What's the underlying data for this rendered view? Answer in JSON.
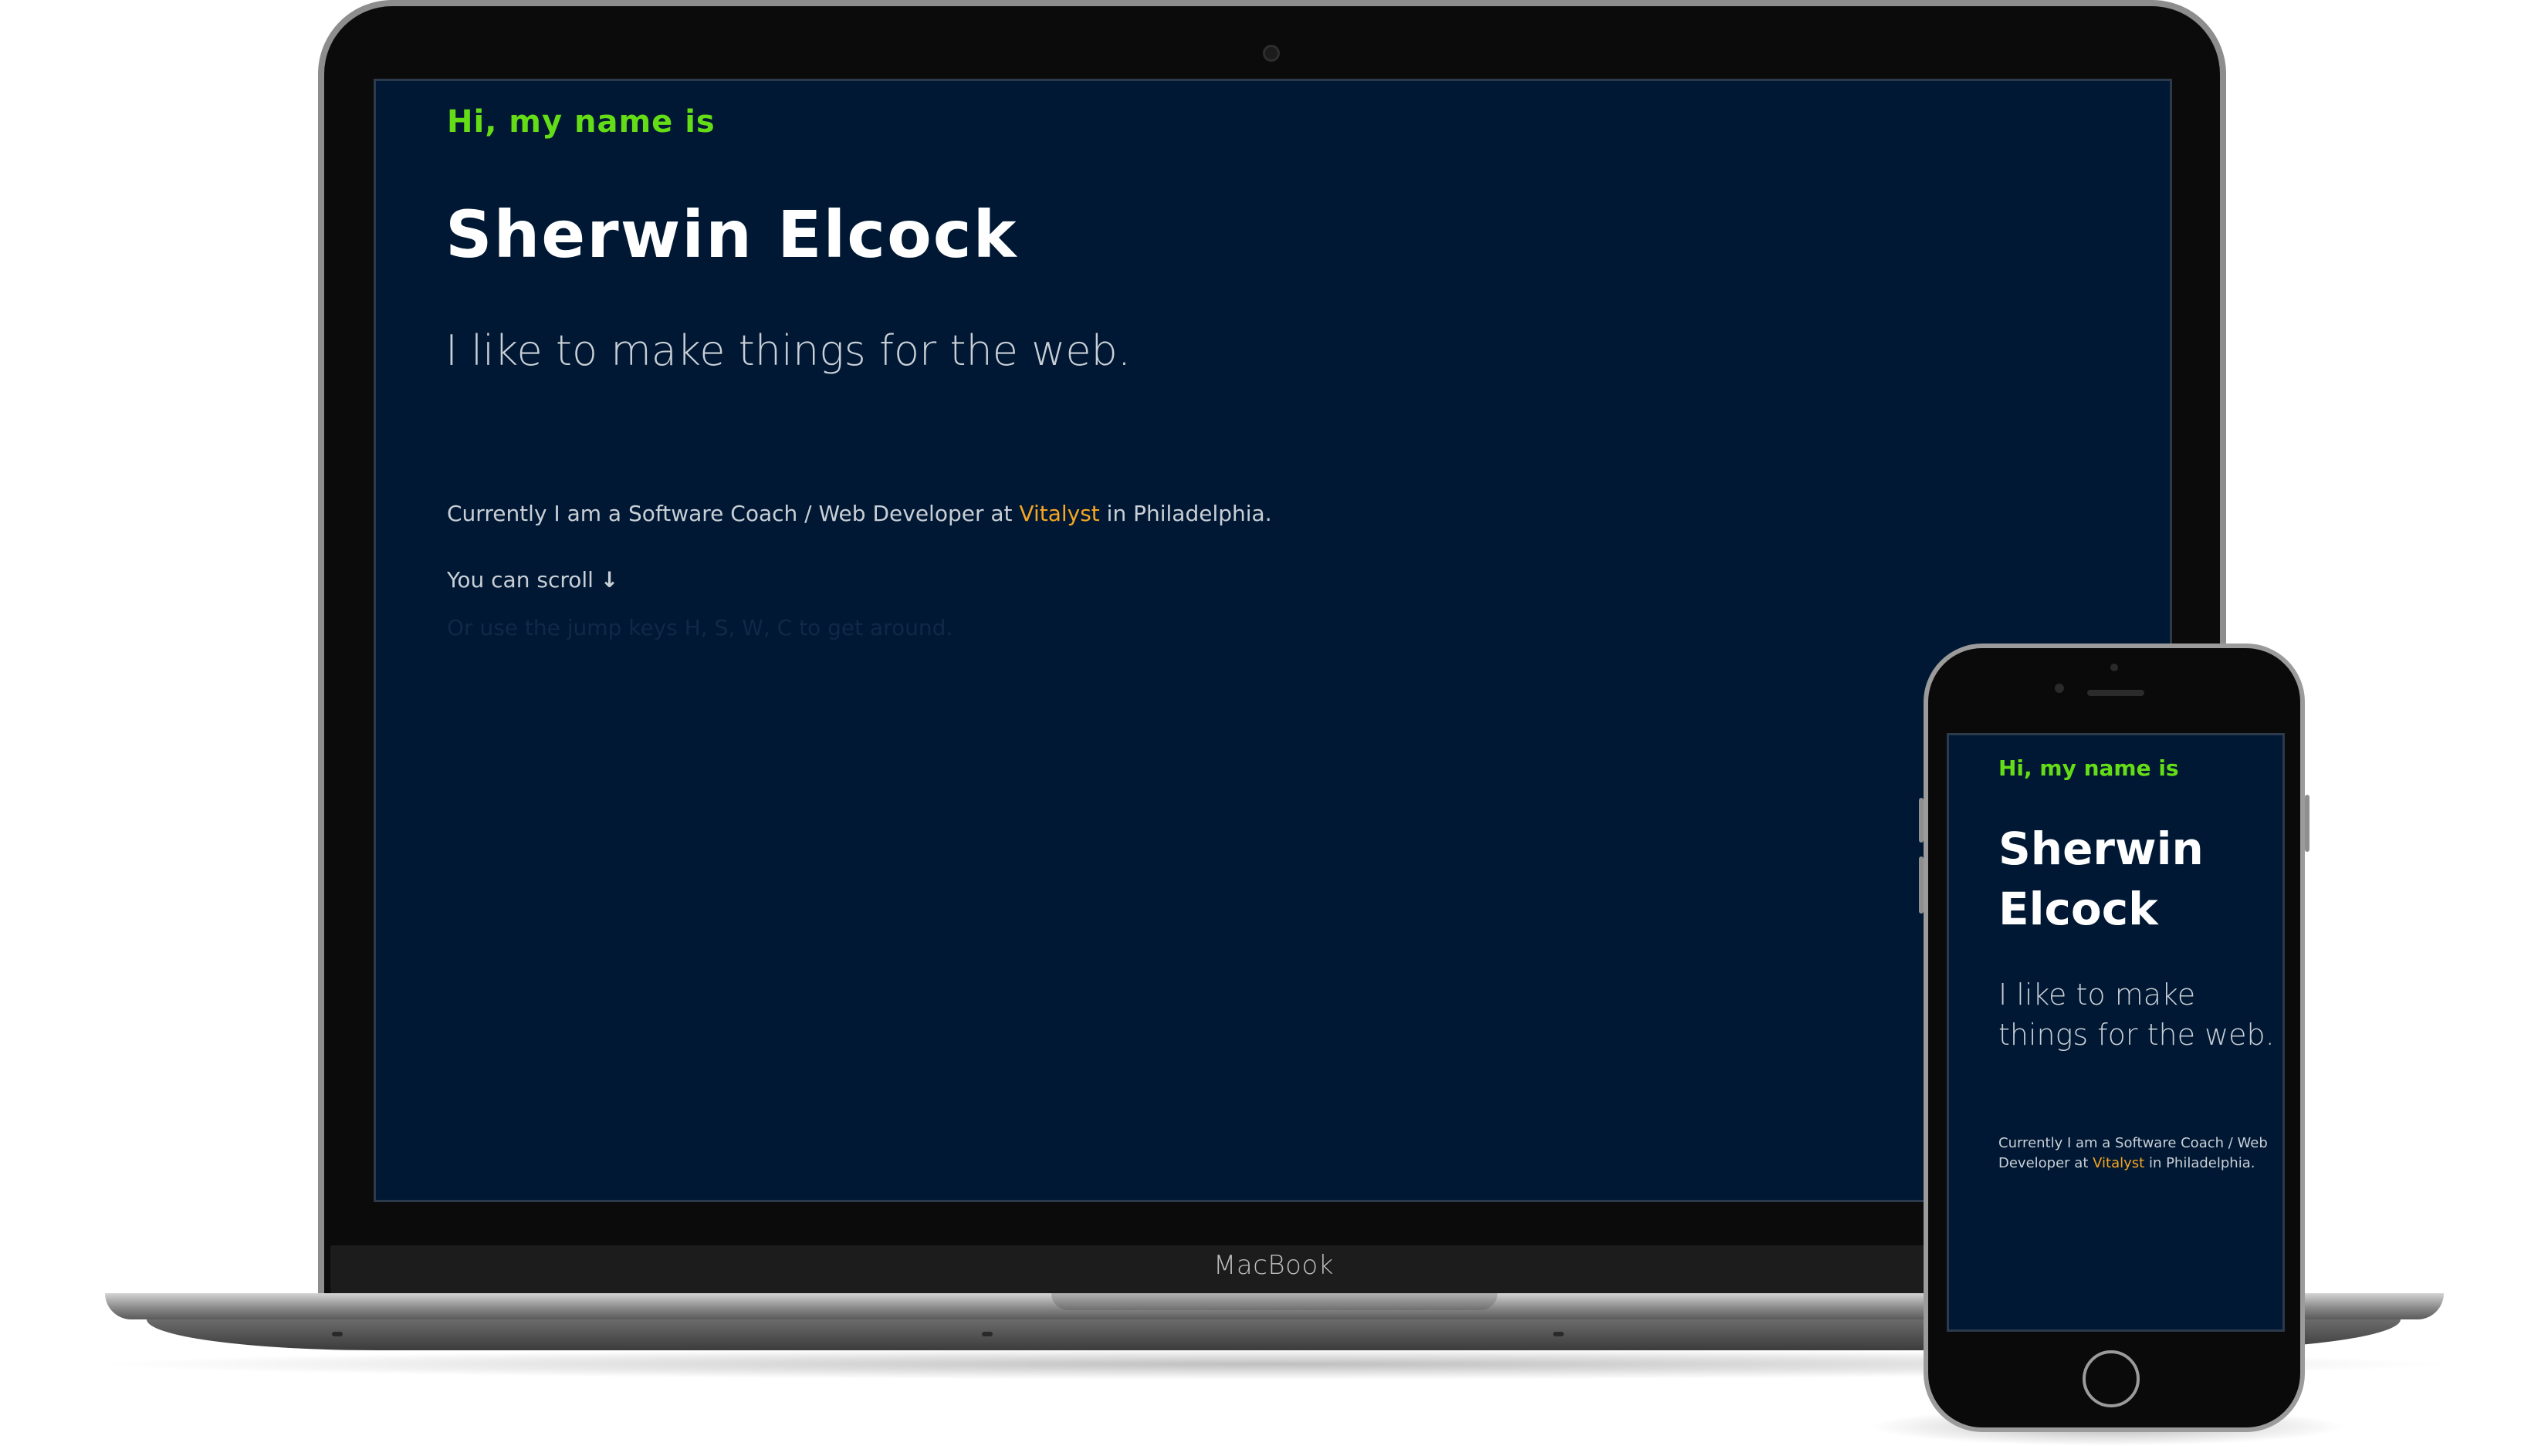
{
  "laptop": {
    "brand": "MacBook",
    "page": {
      "greeting": "Hi, my name is",
      "name": "Sherwin Elcock",
      "tagline": "I like to make things for the web.",
      "intro_before": "Currently I am a Software Coach / Web Developer at ",
      "company": "Vitalyst",
      "intro_after": " in Philadelphia.",
      "scroll_hint": "You can scroll",
      "scroll_icon": "↓",
      "jump_hint": "Or use the jump keys H, S, W, C to get around."
    }
  },
  "phone": {
    "page": {
      "greeting": "Hi, my name is",
      "name": "Sherwin Elcock",
      "tagline": "I like to make things for the web.",
      "intro_before": "Currently I am a Software Coach / Web Developer at ",
      "company": "Vitalyst",
      "intro_after": " in Philadelphia."
    }
  },
  "colors": {
    "background": "#001833",
    "greeting": "#64dd17",
    "accent": "#f5a623",
    "text": "#c9cfd6",
    "heading": "#ffffff"
  }
}
